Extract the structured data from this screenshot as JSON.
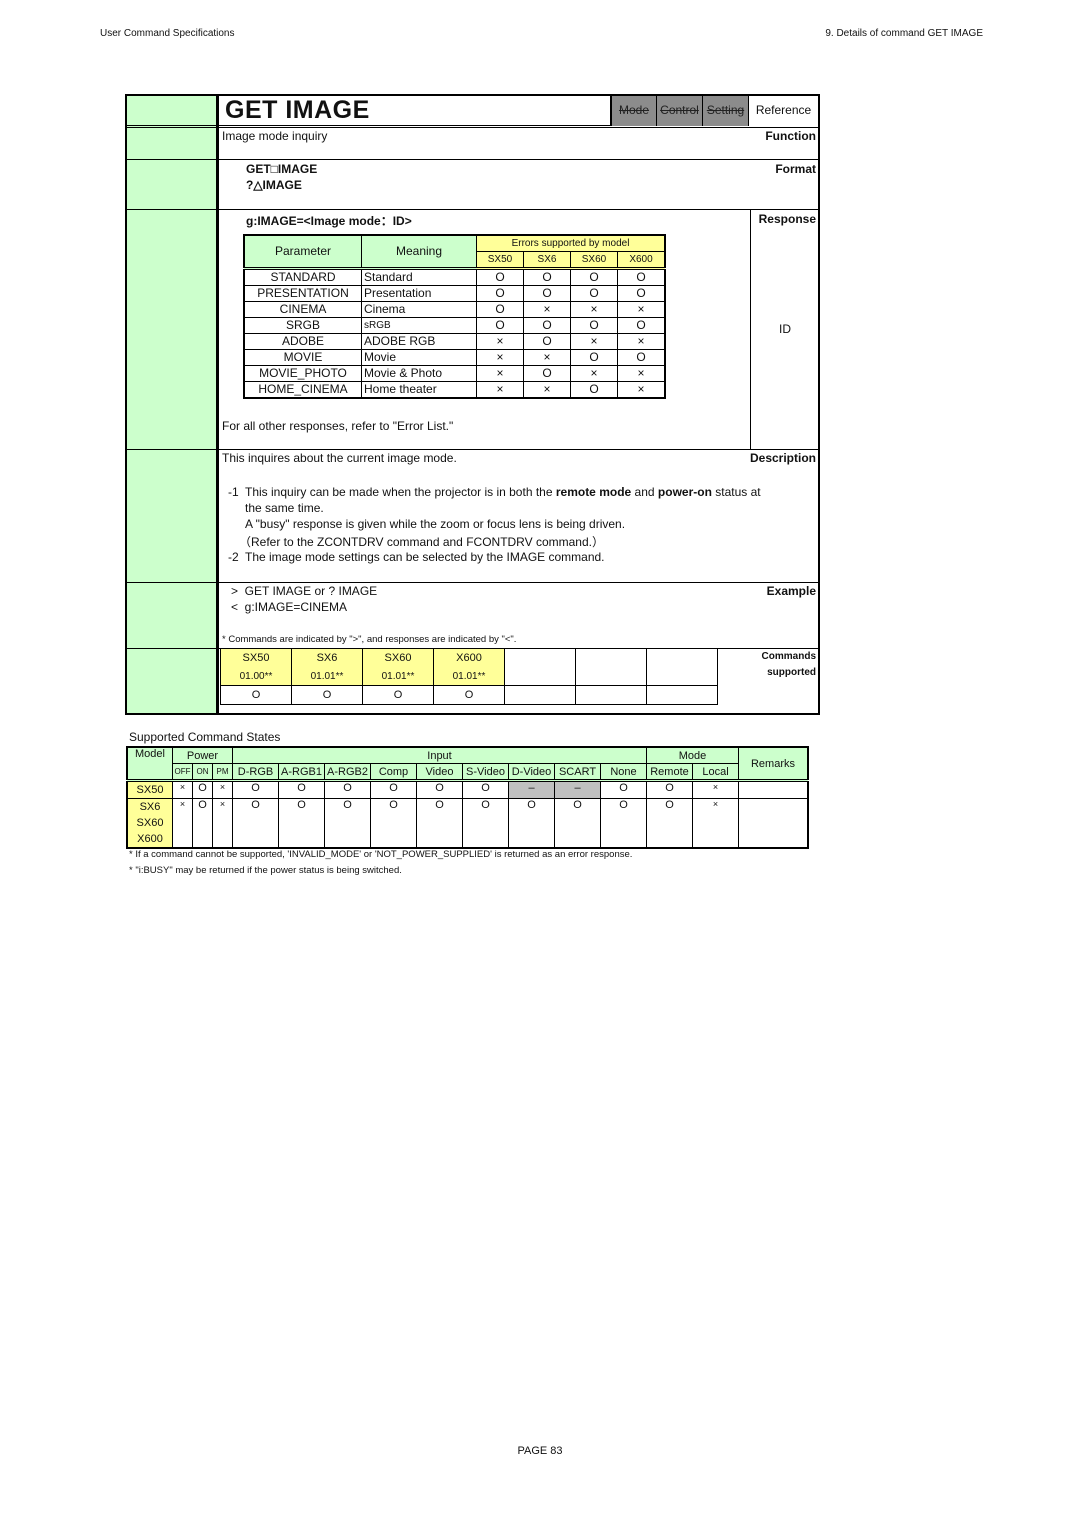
{
  "header": {
    "left": "User Command Specifications",
    "right": "9. Details of command  GET IMAGE"
  },
  "footer": {
    "page": "PAGE 83"
  },
  "command": {
    "label": "Commands",
    "title": "GET IMAGE",
    "tags": [
      {
        "label": "Mode",
        "active": false
      },
      {
        "label": "Control",
        "active": false
      },
      {
        "label": "Setting",
        "active": false
      },
      {
        "label": "Reference",
        "active": true
      }
    ]
  },
  "function": {
    "label": "Function",
    "text": "Image mode inquiry"
  },
  "format": {
    "label": "Format",
    "lines": [
      "GET□IMAGE",
      "?△IMAGE"
    ]
  },
  "response": {
    "label": "Response",
    "syntax": "g:IMAGE=<Image mode：ID>",
    "right_col": "ID",
    "table": {
      "headers": {
        "parameter": "Parameter",
        "meaning": "Meaning",
        "errors": "Errors supported by model"
      },
      "models": [
        "SX50",
        "SX6",
        "SX60",
        "X600"
      ],
      "rows": [
        {
          "param": "STANDARD",
          "meaning": "Standard",
          "support": [
            "O",
            "O",
            "O",
            "O"
          ]
        },
        {
          "param": "PRESENTATION",
          "meaning": "Presentation",
          "support": [
            "O",
            "O",
            "O",
            "O"
          ]
        },
        {
          "param": "CINEMA",
          "meaning": "Cinema",
          "support": [
            "O",
            "×",
            "×",
            "×"
          ]
        },
        {
          "param": "SRGB",
          "meaning": "sRGB",
          "support": [
            "O",
            "O",
            "O",
            "O"
          ]
        },
        {
          "param": "ADOBE",
          "meaning": "ADOBE RGB",
          "support": [
            "×",
            "O",
            "×",
            "×"
          ]
        },
        {
          "param": "MOVIE",
          "meaning": "Movie",
          "support": [
            "×",
            "×",
            "O",
            "O"
          ]
        },
        {
          "param": "MOVIE_PHOTO",
          "meaning": "Movie & Photo",
          "support": [
            "×",
            "O",
            "×",
            "×"
          ]
        },
        {
          "param": "HOME_CINEMA",
          "meaning": "Home theater",
          "support": [
            "×",
            "×",
            "O",
            "×"
          ]
        }
      ]
    },
    "other": "For all other responses, refer to \"Error List.\""
  },
  "description": {
    "label": "Description",
    "intro": "This inquires about the current image mode.",
    "n1": "-1",
    "n1_a": "This inquiry can be made when the projector is in both the ",
    "n1_b": "remote mode",
    "n1_c": " and ",
    "n1_d": "power-on",
    "n1_e": " status at",
    "n1_f": "the same time.",
    "n1_g": "A \"busy\" response is given while the zoom or focus lens is being driven.",
    "n1_h": "（Refer to the ZCONTDRV command and FCONTDRV command.）",
    "n2": "-2",
    "n2_text": "The image mode settings can be selected by the IMAGE command."
  },
  "example": {
    "label": "Example",
    "line1": ">  GET IMAGE or ? IMAGE",
    "line2": "<  g:IMAGE=CINEMA",
    "note": "* Commands are indicated by \">\", and responses are indicated by \"<\"."
  },
  "commands_supported": {
    "label1": "Commands",
    "label2": "supported",
    "models": [
      {
        "name": "SX50",
        "version": "01.00**",
        "mark": "O"
      },
      {
        "name": "SX6",
        "version": "01.01**",
        "mark": "O"
      },
      {
        "name": "SX60",
        "version": "01.01**",
        "mark": "O"
      },
      {
        "name": "X600",
        "version": "01.01**",
        "mark": "O"
      }
    ]
  },
  "supported_states": {
    "title": "Supported Command States",
    "headers": {
      "model": "Model",
      "power": "Power",
      "input": "Input",
      "mode": "Mode",
      "remarks": "Remarks",
      "power_cols": [
        "OFF",
        "ON",
        "PM"
      ],
      "input_cols": [
        "D-RGB",
        "A-RGB1",
        "A-RGB2",
        "Comp",
        "Video",
        "S-Video",
        "D-Video",
        "SCART",
        "None"
      ],
      "mode_cols": [
        "Remote",
        "Local"
      ]
    },
    "rows": [
      {
        "models": [
          "SX50"
        ],
        "power": [
          "×",
          "O",
          "×"
        ],
        "input": [
          "O",
          "O",
          "O",
          "O",
          "O",
          "O",
          "–",
          "–",
          "O"
        ],
        "mode": [
          "O",
          "×"
        ],
        "remarks": ""
      },
      {
        "models": [
          "SX6",
          "SX60",
          "X600"
        ],
        "power": [
          "×",
          "O",
          "×"
        ],
        "input": [
          "O",
          "O",
          "O",
          "O",
          "O",
          "O",
          "O",
          "O",
          "O"
        ],
        "mode": [
          "O",
          "×"
        ],
        "remarks": ""
      }
    ],
    "notes": [
      "* If a command cannot be supported, 'INVALID_MODE' or 'NOT_POWER_SUPPLIED' is returned as an error response.",
      "* \"i:BUSY\" may be returned if the power status is being switched."
    ]
  }
}
